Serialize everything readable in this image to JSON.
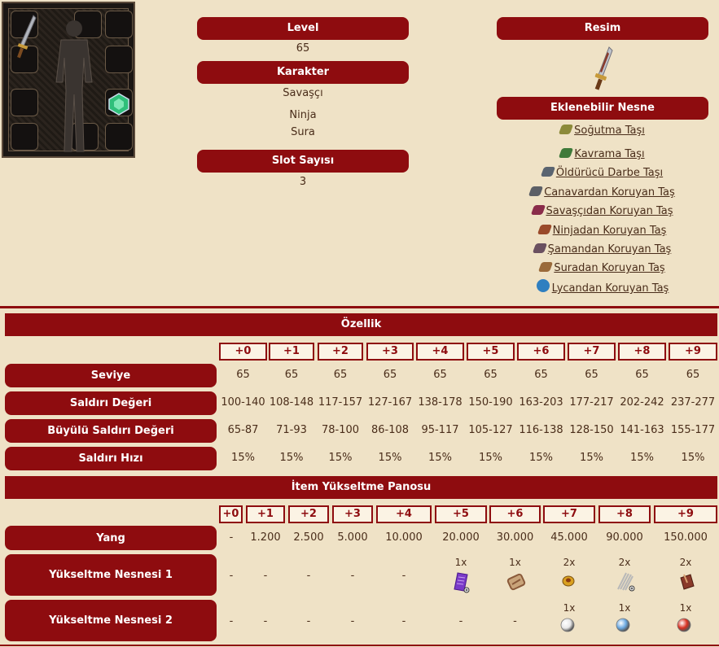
{
  "info": {
    "level_label": "Level",
    "level_value": "65",
    "karakter_label": "Karakter",
    "karakter_values": [
      "Savaşçı",
      "Ninja",
      "Sura"
    ],
    "slot_label": "Slot Sayısı",
    "slot_value": "3",
    "resim_label": "Resim",
    "eklenebilir_label": "Eklenebilir Nesne",
    "addable_items": [
      {
        "label": "Soğutma Taşı",
        "color": "#8c8a3a"
      },
      {
        "label": "Kavrama Taşı",
        "color": "#3f7a3a"
      },
      {
        "label": "Öldürücü Darbe Taşı",
        "color": "#5a6470"
      },
      {
        "label": "Canavardan Koruyan Taş",
        "color": "#5c5f66"
      },
      {
        "label": "Savaşçıdan Koruyan Taş",
        "color": "#8a2c4a"
      },
      {
        "label": "Ninjadan Koruyan Taş",
        "color": "#9a4a2a"
      },
      {
        "label": "Şamandan Koruyan Taş",
        "color": "#6a5060"
      },
      {
        "label": "Suradan Koruyan Taş",
        "color": "#9a6a3a"
      },
      {
        "label": "Lycandan Koruyan Taş",
        "color": "#2f7fc0"
      }
    ]
  },
  "ozellik": {
    "title": "Özellik",
    "headers": [
      "+0",
      "+1",
      "+2",
      "+3",
      "+4",
      "+5",
      "+6",
      "+7",
      "+8",
      "+9"
    ],
    "rows": [
      {
        "label": "Seviye",
        "values": [
          "65",
          "65",
          "65",
          "65",
          "65",
          "65",
          "65",
          "65",
          "65",
          "65"
        ]
      },
      {
        "label": "Saldırı Değeri",
        "values": [
          "100-140",
          "108-148",
          "117-157",
          "127-167",
          "138-178",
          "150-190",
          "163-203",
          "177-217",
          "202-242",
          "237-277"
        ]
      },
      {
        "label": "Büyülü Saldırı Değeri",
        "values": [
          "65-87",
          "71-93",
          "78-100",
          "86-108",
          "95-117",
          "105-127",
          "116-138",
          "128-150",
          "141-163",
          "155-177"
        ]
      },
      {
        "label": "Saldırı Hızı",
        "values": [
          "15%",
          "15%",
          "15%",
          "15%",
          "15%",
          "15%",
          "15%",
          "15%",
          "15%",
          "15%"
        ]
      }
    ]
  },
  "upgrade": {
    "title": "İtem Yükseltme Panosu",
    "headers": [
      "+0",
      "+1",
      "+2",
      "+3",
      "+4",
      "+5",
      "+6",
      "+7",
      "+8",
      "+9"
    ],
    "yang_label": "Yang",
    "yang_values": [
      "-",
      "1.200",
      "2.500",
      "5.000",
      "10.000",
      "20.000",
      "30.000",
      "45.000",
      "90.000",
      "150.000"
    ],
    "item1_label": "Yükseltme Nesnesi 1",
    "item1": [
      {
        "qty": "",
        "dash": "-"
      },
      {
        "qty": "",
        "dash": "-"
      },
      {
        "qty": "",
        "dash": "-"
      },
      {
        "qty": "",
        "dash": "-"
      },
      {
        "qty": "",
        "dash": "-"
      },
      {
        "qty": "1x",
        "icon": "purple-scroll-icon",
        "color": "#7a3ac8"
      },
      {
        "qty": "1x",
        "icon": "bundle-icon",
        "color": "#8a5a3a"
      },
      {
        "qty": "2x",
        "icon": "gold-ring-icon",
        "color": "#d9a020"
      },
      {
        "qty": "2x",
        "icon": "silver-hair-icon",
        "color": "#b8b8b8"
      },
      {
        "qty": "2x",
        "icon": "leather-pouch-icon",
        "color": "#8a3a2a"
      }
    ],
    "item2_label": "Yükseltme Nesnesi 2",
    "item2": [
      {
        "qty": "",
        "dash": "-"
      },
      {
        "qty": "",
        "dash": "-"
      },
      {
        "qty": "",
        "dash": "-"
      },
      {
        "qty": "",
        "dash": "-"
      },
      {
        "qty": "",
        "dash": "-"
      },
      {
        "qty": "",
        "dash": "-"
      },
      {
        "qty": "",
        "dash": "-"
      },
      {
        "qty": "1x",
        "icon": "white-orb-icon",
        "color": "#e8e8e8"
      },
      {
        "qty": "1x",
        "icon": "blue-orb-icon",
        "color": "#6aa8e0"
      },
      {
        "qty": "1x",
        "icon": "red-orb-icon",
        "color": "#d83020"
      }
    ]
  }
}
